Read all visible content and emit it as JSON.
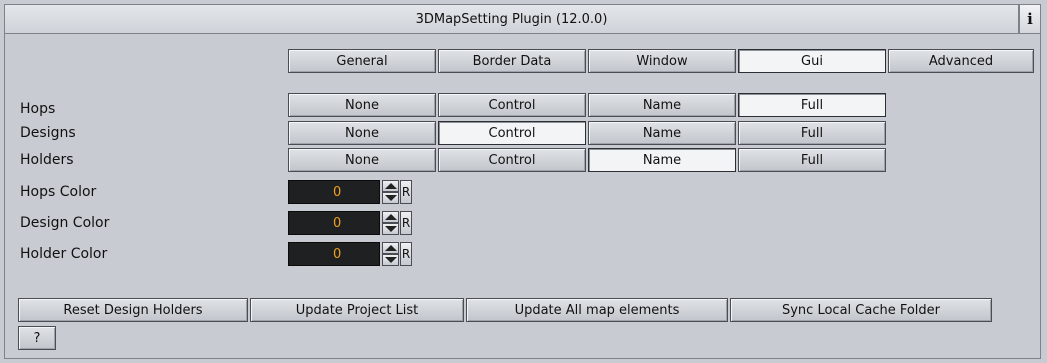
{
  "window": {
    "title": "3DMapSetting Plugin (12.0.0)",
    "info_label": "i"
  },
  "tabs": [
    {
      "label": "General",
      "active": false
    },
    {
      "label": "Border Data",
      "active": false
    },
    {
      "label": "Window",
      "active": false
    },
    {
      "label": "Gui",
      "active": true
    },
    {
      "label": "Advanced",
      "active": false
    }
  ],
  "gui": {
    "option_rows": [
      {
        "label": "Hops",
        "options": [
          "None",
          "Control",
          "Name",
          "Full"
        ],
        "selected": "Full"
      },
      {
        "label": "Designs",
        "options": [
          "None",
          "Control",
          "Name",
          "Full"
        ],
        "selected": "Control"
      },
      {
        "label": "Holders",
        "options": [
          "None",
          "Control",
          "Name",
          "Full"
        ],
        "selected": "Name"
      }
    ],
    "color_rows": [
      {
        "label": "Hops Color",
        "value": "0",
        "reset_label": "R"
      },
      {
        "label": "Design Color",
        "value": "0",
        "reset_label": "R"
      },
      {
        "label": "Holder Color",
        "value": "0",
        "reset_label": "R"
      }
    ]
  },
  "actions": {
    "reset_design_holders": "Reset Design Holders",
    "update_project_list": "Update Project List",
    "update_all_map_elements": "Update All map elements",
    "sync_local_cache_folder": "Sync Local Cache Folder",
    "help": "?"
  },
  "colors": {
    "background": "#c8ccd2",
    "number_field_bg": "#1f2022",
    "number_text": "#f0a020"
  },
  "icons": [
    "info-icon",
    "spin-up-icon",
    "spin-down-icon"
  ]
}
